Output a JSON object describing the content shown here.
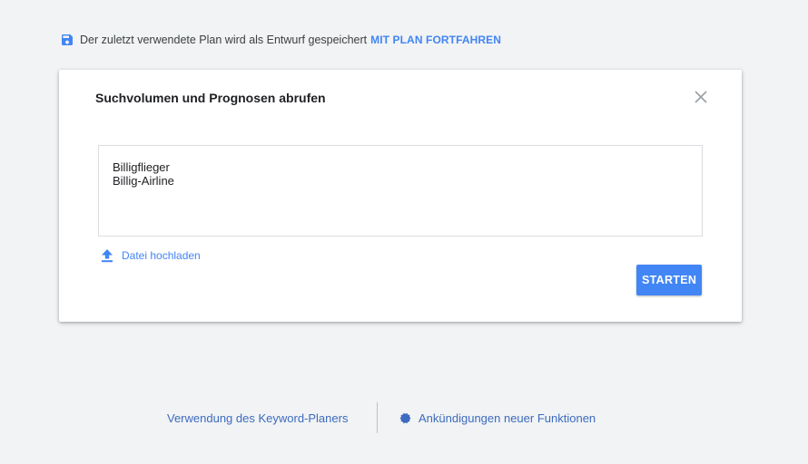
{
  "draft_bar": {
    "message": "Der zuletzt verwendete Plan wird als Entwurf gespeichert",
    "continue_link": "MIT PLAN FORTFAHREN"
  },
  "dialog": {
    "title": "Suchvolumen und Prognosen abrufen",
    "keywords": [
      "Billigflieger",
      "Billig-Airline"
    ],
    "upload_label": "Datei hochladen",
    "start_button": "STARTEN"
  },
  "footer": {
    "help_link": "Verwendung des Keyword-Planers",
    "news_link": "Ankündigungen neuer Funktionen"
  },
  "colors": {
    "accent": "#4285f4",
    "background": "#f1f3f4",
    "footer_link": "#3d6bbf"
  },
  "icons": {
    "draft": "save-icon",
    "close": "close-icon",
    "upload": "upload-icon",
    "news": "badge-icon"
  }
}
